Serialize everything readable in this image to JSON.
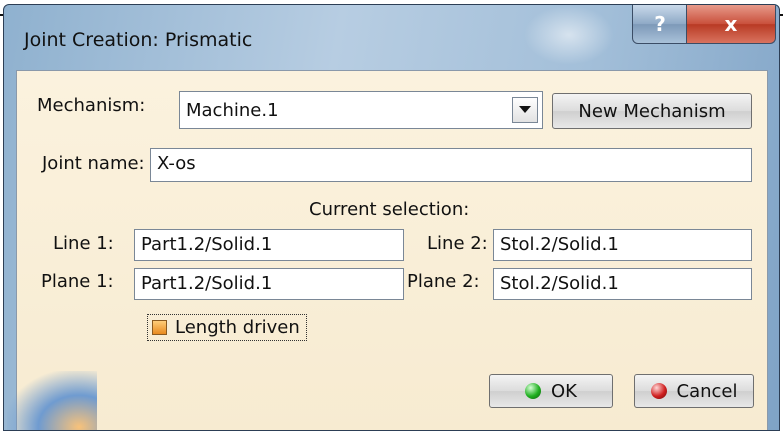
{
  "window": {
    "title": "Joint Creation: Prismatic",
    "help_label": "?",
    "close_label": "x"
  },
  "mechanism": {
    "label": "Mechanism:",
    "value": "Machine.1",
    "new_button": "New Mechanism"
  },
  "joint": {
    "label": "Joint name:",
    "value": "X-os"
  },
  "selection": {
    "heading": "Current selection:",
    "line1_label": "Line 1:",
    "line1_value": "Part1.2/Solid.1",
    "line2_label": "Line 2:",
    "line2_value": "Stol.2/Solid.1",
    "plane1_label": "Plane 1:",
    "plane1_value": "Part1.2/Solid.1",
    "plane2_label": "Plane 2:",
    "plane2_value": "Stol.2/Solid.1"
  },
  "length_driven": {
    "label": "Length driven",
    "checked": false
  },
  "buttons": {
    "ok": "OK",
    "cancel": "Cancel"
  },
  "colors": {
    "client_bg": "#fbf2de",
    "title_bar": "#a3bfd9",
    "close_red": "#c9503c"
  },
  "icons": [
    "help-icon",
    "close-icon",
    "dropdown-arrow-icon",
    "ok-green-ball-icon",
    "cancel-red-ball-icon",
    "checkbox-icon"
  ]
}
